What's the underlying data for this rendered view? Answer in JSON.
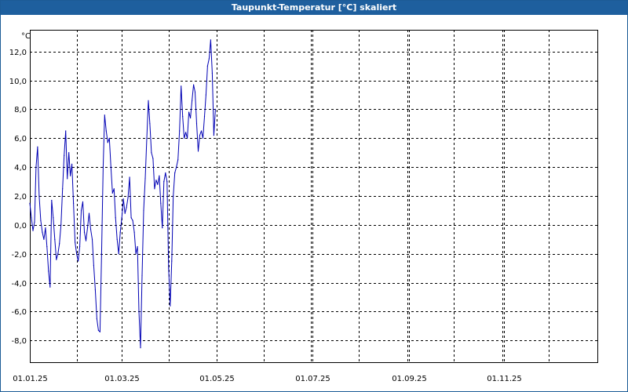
{
  "window": {
    "title": "Taupunkt-Temperatur [°C] skaliert"
  },
  "colors": {
    "titlebar": "#1e5f9e",
    "series": "#0000b4",
    "grid": "#000000",
    "axis": "#000000"
  },
  "chart_data": {
    "type": "line",
    "title": "Taupunkt-Temperatur [°C] skaliert",
    "ylabel": "°C",
    "xlabel": "",
    "grid": true,
    "grid_style": "dashed",
    "legend": "none",
    "xlim": [
      "2025-01-01",
      "2025-12-31"
    ],
    "ylim": [
      -9.5,
      13.5
    ],
    "y_ticks": [
      -8,
      -6,
      -4,
      -2,
      0,
      2,
      4,
      6,
      8,
      10,
      12
    ],
    "y_tick_labels": [
      "-8,0",
      "-6,0",
      "-4,0",
      "-2,0",
      "0,0",
      "2,0",
      "4,0",
      "6,0",
      "8,0",
      "10,0",
      "12,0"
    ],
    "x_ticks": [
      "2025-01-01",
      "2025-03-01",
      "2025-05-01",
      "2025-07-01",
      "2025-09-01",
      "2025-11-01"
    ],
    "x_tick_labels": [
      "01.01.25",
      "01.03.25",
      "01.05.25",
      "01.07.25",
      "01.09.25",
      "01.11.25"
    ],
    "x_minor_gridlines": [
      "2025-01-31",
      "2025-03-31",
      "2025-05-31",
      "2025-06-30",
      "2025-07-31",
      "2025-08-31",
      "2025-09-30",
      "2025-10-31",
      "2025-11-30",
      "2025-12-31"
    ],
    "series": [
      {
        "points": [
          [
            "2025-01-01",
            1.5
          ],
          [
            "2025-01-02",
            0.5
          ],
          [
            "2025-01-03",
            -0.4
          ],
          [
            "2025-01-04",
            0.2
          ],
          [
            "2025-01-05",
            4.0
          ],
          [
            "2025-01-06",
            5.4
          ],
          [
            "2025-01-07",
            2.0
          ],
          [
            "2025-01-08",
            0.3
          ],
          [
            "2025-01-09",
            -0.5
          ],
          [
            "2025-01-10",
            -1.0
          ],
          [
            "2025-01-11",
            -0.2
          ],
          [
            "2025-01-12",
            -1.5
          ],
          [
            "2025-01-13",
            -3.2
          ],
          [
            "2025-01-14",
            -4.3
          ],
          [
            "2025-01-15",
            1.7
          ],
          [
            "2025-01-16",
            0.5
          ],
          [
            "2025-01-17",
            -1.0
          ],
          [
            "2025-01-18",
            -2.4
          ],
          [
            "2025-01-19",
            -2.0
          ],
          [
            "2025-01-20",
            -1.3
          ],
          [
            "2025-01-21",
            0.0
          ],
          [
            "2025-01-22",
            2.5
          ],
          [
            "2025-01-23",
            4.8
          ],
          [
            "2025-01-24",
            6.5
          ],
          [
            "2025-01-25",
            3.2
          ],
          [
            "2025-01-26",
            5.0
          ],
          [
            "2025-01-27",
            3.4
          ],
          [
            "2025-01-28",
            4.2
          ],
          [
            "2025-01-29",
            1.5
          ],
          [
            "2025-01-30",
            -1.2
          ],
          [
            "2025-01-31",
            -2.0
          ],
          [
            "2025-02-01",
            -2.5
          ],
          [
            "2025-02-02",
            -1.5
          ],
          [
            "2025-02-03",
            1.0
          ],
          [
            "2025-02-04",
            1.6
          ],
          [
            "2025-02-05",
            -0.5
          ],
          [
            "2025-02-06",
            -1.1
          ],
          [
            "2025-02-07",
            -0.2
          ],
          [
            "2025-02-08",
            0.8
          ],
          [
            "2025-02-09",
            -0.3
          ],
          [
            "2025-02-10",
            -1.0
          ],
          [
            "2025-02-11",
            -2.8
          ],
          [
            "2025-02-12",
            -4.5
          ],
          [
            "2025-02-13",
            -6.5
          ],
          [
            "2025-02-14",
            -7.3
          ],
          [
            "2025-02-15",
            -7.4
          ],
          [
            "2025-02-16",
            -2.0
          ],
          [
            "2025-02-17",
            4.0
          ],
          [
            "2025-02-18",
            7.6
          ],
          [
            "2025-02-19",
            6.5
          ],
          [
            "2025-02-20",
            5.7
          ],
          [
            "2025-02-21",
            6.0
          ],
          [
            "2025-02-22",
            4.0
          ],
          [
            "2025-02-23",
            2.2
          ],
          [
            "2025-02-24",
            2.5
          ],
          [
            "2025-02-25",
            0.5
          ],
          [
            "2025-02-26",
            -1.0
          ],
          [
            "2025-02-27",
            -2.0
          ],
          [
            "2025-02-28",
            -0.5
          ],
          [
            "2025-03-01",
            0.5
          ],
          [
            "2025-03-02",
            1.8
          ],
          [
            "2025-03-03",
            0.8
          ],
          [
            "2025-03-04",
            1.2
          ],
          [
            "2025-03-05",
            1.9
          ],
          [
            "2025-03-06",
            3.3
          ],
          [
            "2025-03-07",
            0.5
          ],
          [
            "2025-03-08",
            0.3
          ],
          [
            "2025-03-09",
            -0.5
          ],
          [
            "2025-03-10",
            -2.0
          ],
          [
            "2025-03-11",
            -1.5
          ],
          [
            "2025-03-12",
            -6.0
          ],
          [
            "2025-03-13",
            -8.5
          ],
          [
            "2025-03-14",
            -3.5
          ],
          [
            "2025-03-15",
            1.0
          ],
          [
            "2025-03-16",
            3.2
          ],
          [
            "2025-03-17",
            6.0
          ],
          [
            "2025-03-18",
            8.6
          ],
          [
            "2025-03-19",
            7.0
          ],
          [
            "2025-03-20",
            5.0
          ],
          [
            "2025-03-21",
            4.6
          ],
          [
            "2025-03-22",
            2.5
          ],
          [
            "2025-03-23",
            3.1
          ],
          [
            "2025-03-24",
            2.8
          ],
          [
            "2025-03-25",
            3.4
          ],
          [
            "2025-03-26",
            1.5
          ],
          [
            "2025-03-27",
            -0.2
          ],
          [
            "2025-03-28",
            3.0
          ],
          [
            "2025-03-29",
            3.6
          ],
          [
            "2025-03-30",
            3.0
          ],
          [
            "2025-03-31",
            -3.0
          ],
          [
            "2025-04-01",
            -5.6
          ],
          [
            "2025-04-02",
            -2.5
          ],
          [
            "2025-04-03",
            2.0
          ],
          [
            "2025-04-04",
            3.6
          ],
          [
            "2025-04-05",
            4.0
          ],
          [
            "2025-04-06",
            4.5
          ],
          [
            "2025-04-07",
            6.5
          ],
          [
            "2025-04-08",
            9.6
          ],
          [
            "2025-04-09",
            7.5
          ],
          [
            "2025-04-10",
            6.0
          ],
          [
            "2025-04-11",
            6.4
          ],
          [
            "2025-04-12",
            6.0
          ],
          [
            "2025-04-13",
            7.8
          ],
          [
            "2025-04-14",
            7.4
          ],
          [
            "2025-04-15",
            8.6
          ],
          [
            "2025-04-16",
            9.7
          ],
          [
            "2025-04-17",
            9.2
          ],
          [
            "2025-04-18",
            7.0
          ],
          [
            "2025-04-19",
            5.1
          ],
          [
            "2025-04-20",
            6.2
          ],
          [
            "2025-04-21",
            6.5
          ],
          [
            "2025-04-22",
            6.0
          ],
          [
            "2025-04-23",
            7.5
          ],
          [
            "2025-04-24",
            9.0
          ],
          [
            "2025-04-25",
            11.0
          ],
          [
            "2025-04-26",
            11.5
          ],
          [
            "2025-04-27",
            12.8
          ],
          [
            "2025-04-28",
            10.5
          ],
          [
            "2025-04-29",
            6.2
          ],
          [
            "2025-04-30",
            8.0
          ]
        ]
      }
    ]
  }
}
